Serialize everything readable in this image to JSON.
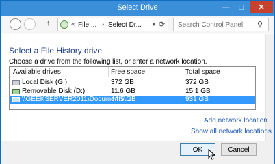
{
  "window": {
    "title": "Select Drive",
    "minimize": "—",
    "maximize": "□",
    "close": "✕"
  },
  "nav": {
    "back": "←",
    "forward": "→",
    "up": "↑",
    "address": {
      "sep1": "«",
      "crumb1": "File ...",
      "sep2": "›",
      "crumb2": "Select Dr...",
      "dropdown": "▼",
      "refresh": "⟳"
    },
    "search_placeholder": "Search Control Panel",
    "search_icon": "⚲"
  },
  "main": {
    "heading": "Select a File History drive",
    "instruction": "Choose a drive from the following list, or enter a network location.",
    "columns": [
      "Available drives",
      "Free space",
      "Total space"
    ],
    "drives": [
      {
        "name": "Local Disk (G:)",
        "free": "372 GB",
        "total": "372 GB",
        "icon": "hard-drive-icon",
        "selected": false
      },
      {
        "name": "Removable Disk (D:)",
        "free": "11.6 GB",
        "total": "15.1 GB",
        "icon": "removable-drive-icon",
        "selected": false
      },
      {
        "name": "\\\\GEEKSERVER2011\\Documents\\...",
        "free": "44.5 GB",
        "total": "931 GB",
        "icon": "network-drive-icon",
        "selected": true
      }
    ],
    "add_network_location": "Add network location",
    "show_all_network_locations": "Show all network locations"
  },
  "footer": {
    "ok_label": "OK",
    "cancel_label": "Cancel"
  },
  "colors": {
    "titlebar": "#3a8fd8",
    "close": "#c7412d",
    "heading": "#1e3f88",
    "selection": "#3399ff",
    "link": "#1e58b4"
  }
}
